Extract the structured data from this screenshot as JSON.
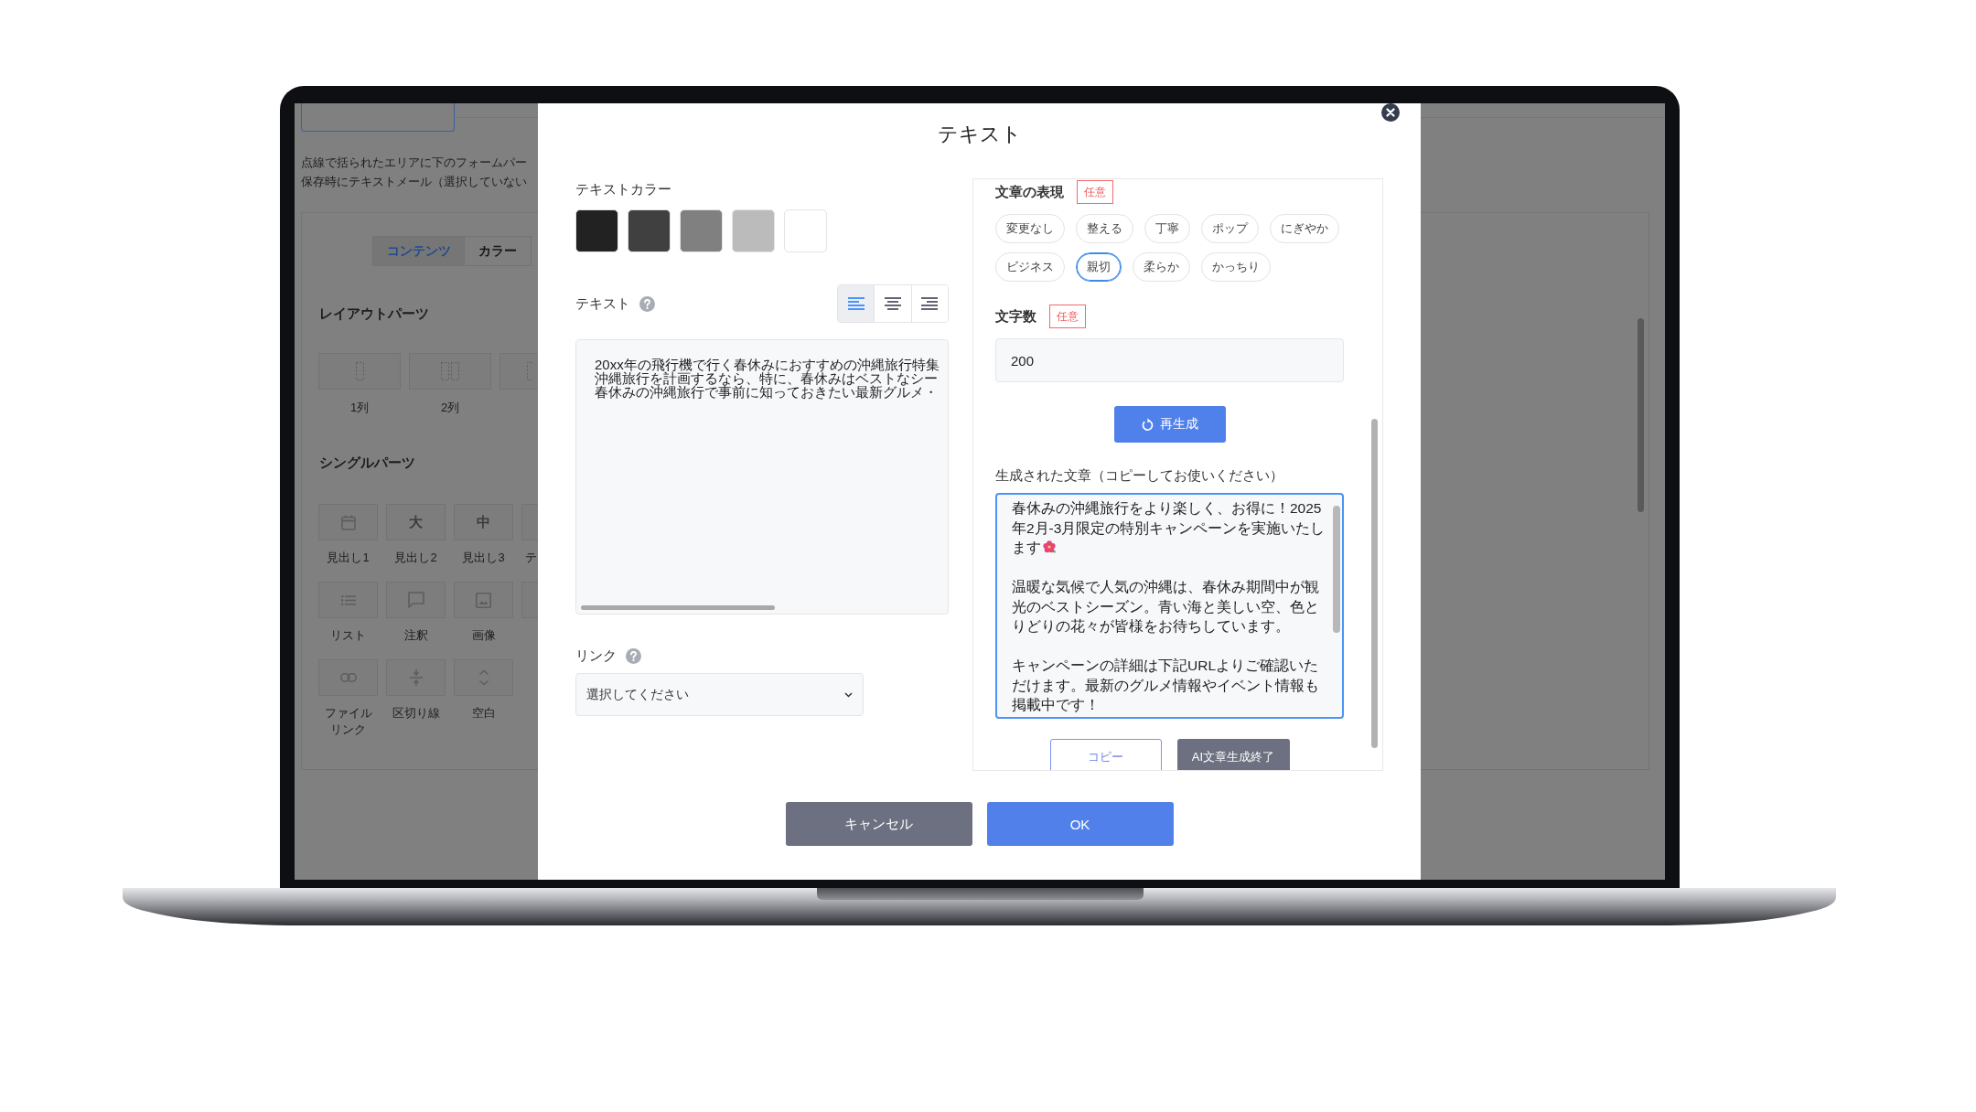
{
  "background_page": {
    "instructions": [
      "点線で括られたエリアに下のフォームパー",
      "保存時にテキストメール（選択していない"
    ],
    "tabs": [
      {
        "label": "コンテンツ",
        "selected": true
      },
      {
        "label": "カラー",
        "selected": false
      }
    ],
    "layout_parts": {
      "title": "レイアウトパーツ",
      "items": [
        {
          "kind": "single",
          "label": "1列"
        },
        {
          "kind": "double",
          "label": "2列"
        },
        {
          "kind": "triple"
        }
      ]
    },
    "single_parts": {
      "title": "シングルパーツ",
      "rows": [
        {
          "items": [
            {
              "kind": "calendar",
              "label": "見出し1"
            },
            {
              "kind": "glyph",
              "glyph": "大",
              "label": "見出し2"
            },
            {
              "kind": "glyph",
              "glyph": "中",
              "label": "見出し3"
            },
            {
              "kind": "covered",
              "label": "テ"
            }
          ]
        },
        {
          "items": [
            {
              "kind": "list",
              "label": "リスト"
            },
            {
              "kind": "comment",
              "label": "注釈"
            },
            {
              "kind": "image",
              "label": "画像"
            },
            {
              "kind": "covered"
            }
          ]
        },
        {
          "items": [
            {
              "kind": "link",
              "label": "ファイルリンク"
            },
            {
              "kind": "divider",
              "label": "区切り線"
            },
            {
              "kind": "spacing",
              "label": "空白"
            }
          ]
        }
      ]
    }
  },
  "modal": {
    "title": "テキスト",
    "text_color": {
      "label": "テキストカラー",
      "swatches": [
        {
          "color": "#222222"
        },
        {
          "color": "#404040"
        },
        {
          "color": "#808080"
        },
        {
          "color": "#bbbbbb"
        },
        {
          "color": "#ffffff"
        }
      ]
    },
    "text_field": {
      "label": "テキスト",
      "alignment": [
        {
          "kind": "left",
          "selected": true
        },
        {
          "kind": "center",
          "selected": false
        },
        {
          "kind": "right",
          "selected": false
        }
      ],
      "lines": [
        "20xx年の飛行機で行く春休みにおすすめの沖縄旅行特集",
        "沖縄旅行を計画するなら、特に、春休みはベストなシー",
        "春休みの沖縄旅行で事前に知っておきたい最新グルメ・"
      ]
    },
    "link": {
      "label": "リンク",
      "value": "選択してください"
    },
    "expression": {
      "label": "文章の表現",
      "badge": "任意",
      "options": [
        {
          "label": "変更なし",
          "selected": false
        },
        {
          "label": "整える",
          "selected": false
        },
        {
          "label": "丁寧",
          "selected": false
        },
        {
          "label": "ポップ",
          "selected": false
        },
        {
          "label": "にぎやか",
          "selected": false
        },
        {
          "label": "ビジネス",
          "selected": false
        },
        {
          "label": "親切",
          "selected": true
        },
        {
          "label": "柔らか",
          "selected": false
        },
        {
          "label": "かっちり",
          "selected": false
        }
      ]
    },
    "char_count": {
      "label": "文字数",
      "badge": "任意",
      "value": "200"
    },
    "regenerate_button": "再生成",
    "generated": {
      "label": "生成された文章（コピーしてお使いください）",
      "paragraphs": [
        {
          "kind": "with-icon",
          "lines": [
            "春休みの沖縄旅行をより楽しく、お得に！2025",
            "年2月-3月限定の特別キャンペーンを実施いたし",
            "ます"
          ]
        },
        {
          "kind": "plain",
          "lines": [
            "温暖な気候で人気の沖縄は、春休み期間中が観",
            "光のベストシーズン。青い海と美しい空、色と",
            "りどりの花々が皆様をお待ちしています。"
          ]
        },
        {
          "kind": "plain",
          "lines": [
            "キャンペーンの詳細は下記URLよりご確認いた",
            "だけます。最新のグルメ情報やイベント情報も",
            "掲載中です！"
          ]
        }
      ]
    },
    "copy_button": "コピー",
    "finish_button": "AI文章生成終了",
    "footer": {
      "cancel": "キャンセル",
      "ok": "OK"
    }
  }
}
